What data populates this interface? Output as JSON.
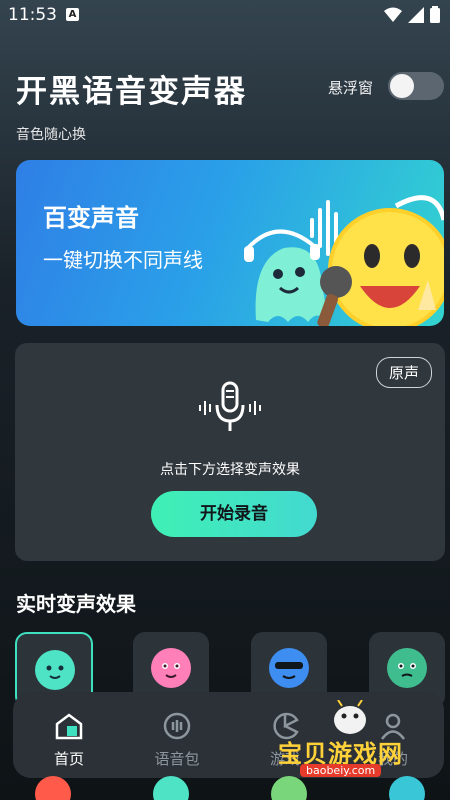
{
  "status_bar": {
    "time": "11:53",
    "app_icon": "A"
  },
  "header": {
    "title": "开黑语音变声器",
    "subtitle": "音色随心换",
    "floating_window_label": "悬浮窗",
    "floating_window_on": false
  },
  "banner": {
    "title": "百变声音",
    "subtitle": "一键切换不同声线"
  },
  "record_card": {
    "original_button": "原声",
    "hint": "点击下方选择变声效果",
    "record_button": "开始录音"
  },
  "effects_section": {
    "title": "实时变声效果",
    "items": [
      {
        "icon": "ghost-face-icon",
        "color": "#4fe3c6",
        "selected": true
      },
      {
        "icon": "pink-face-icon",
        "color": "#ff7fb8",
        "selected": false
      },
      {
        "icon": "cool-face-icon",
        "color": "#3e8df0",
        "selected": false
      },
      {
        "icon": "green-face-icon",
        "color": "#3fbd8f",
        "selected": false
      }
    ]
  },
  "bottom_nav": {
    "items": [
      {
        "label": "首页",
        "active": true,
        "icon": "home-icon"
      },
      {
        "label": "语音包",
        "active": false,
        "icon": "voice-pack-icon"
      },
      {
        "label": "游戏",
        "active": false,
        "icon": "game-icon"
      },
      {
        "label": "我的",
        "active": false,
        "icon": "profile-icon"
      }
    ]
  },
  "watermark": {
    "text": "宝贝游戏网",
    "url": "baobeiy.com"
  }
}
